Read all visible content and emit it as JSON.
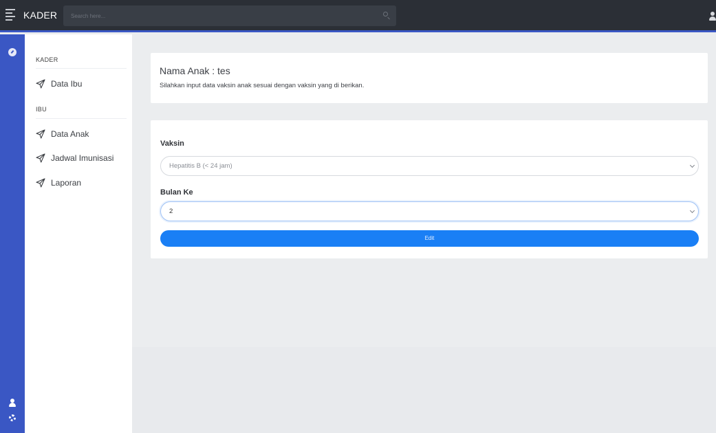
{
  "topbar": {
    "brand": "KADER",
    "search_placeholder": "Search here..."
  },
  "sidebar": {
    "sections": [
      {
        "title": "KADER",
        "items": [
          {
            "label": "Data Ibu"
          }
        ]
      },
      {
        "title": "IBU",
        "items": [
          {
            "label": "Data Anak"
          },
          {
            "label": "Jadwal Imunisasi"
          },
          {
            "label": "Laporan"
          }
        ]
      }
    ],
    "icons": {
      "nav": "send-icon",
      "rail": [
        "dashboard-icon",
        "user-icon",
        "gear-icon"
      ]
    }
  },
  "info_card": {
    "title": "Nama Anak : tes",
    "subtitle": "Silahkan input data vaksin anak sesuai dengan vaksin yang di berikan."
  },
  "form": {
    "vaksin_label": "Vaksin",
    "vaksin_value": "Hepatitis B (< 24 jam)",
    "bulan_label": "Bulan Ke",
    "bulan_value": "2",
    "submit_label": "Edit"
  },
  "colors": {
    "topbar": "#2b2f36",
    "accent": "#3a57c4",
    "button": "#1a7ff5",
    "page_bg": "#ebedef"
  }
}
